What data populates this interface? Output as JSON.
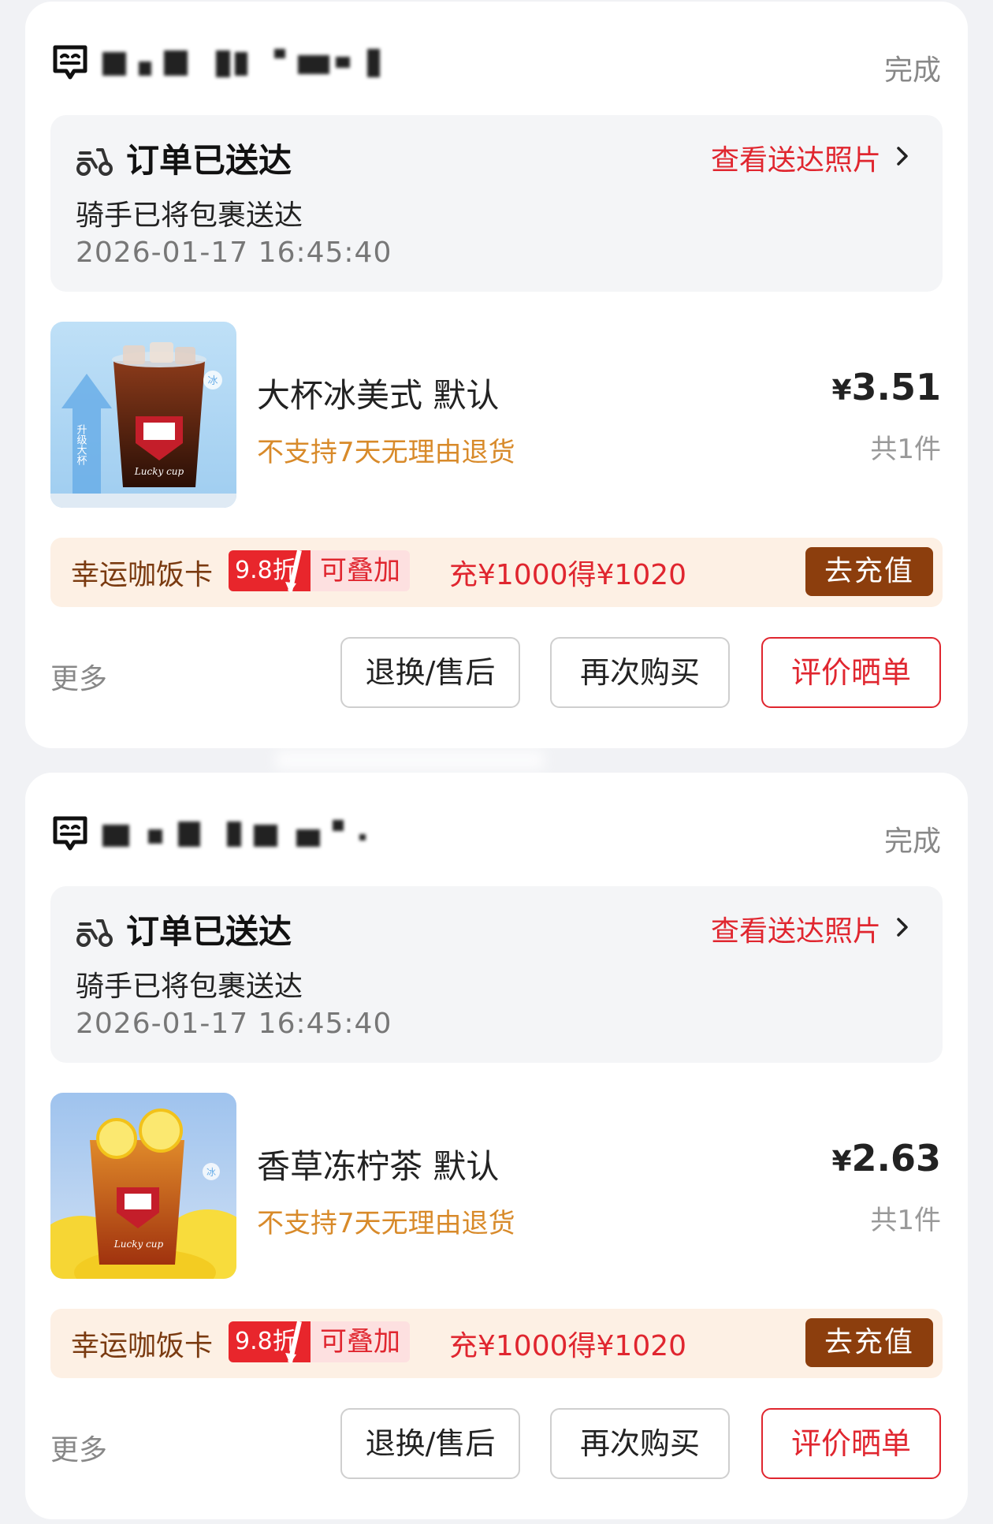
{
  "orders": [
    {
      "status": "完成",
      "delivery": {
        "title": "订单已送达",
        "desc": "骑手已将包裹送达",
        "time": "2026-01-17 16:45:40",
        "photo_link": "查看送达照片"
      },
      "product": {
        "name": "大杯冰美式 默认",
        "note": "不支持7天无理由退货",
        "price_symbol": "¥",
        "price": "3.51",
        "qty": "共1件",
        "image": "iced-americano-cup"
      },
      "promo": {
        "card_name": "幸运咖饭卡",
        "discount": "9.8折",
        "stackable": "可叠加",
        "offer": "充¥1000得¥1020",
        "button": "去充值"
      },
      "actions": {
        "more": "更多",
        "refund": "退换/售后",
        "rebuy": "再次购买",
        "review": "评价晒单"
      }
    },
    {
      "status": "完成",
      "delivery": {
        "title": "订单已送达",
        "desc": "骑手已将包裹送达",
        "time": "2026-01-17 16:45:40",
        "photo_link": "查看送达照片"
      },
      "product": {
        "name": "香草冻柠茶 默认",
        "note": "不支持7天无理由退货",
        "price_symbol": "¥",
        "price": "2.63",
        "qty": "共1件",
        "image": "lemon-tea-cup"
      },
      "promo": {
        "card_name": "幸运咖饭卡",
        "discount": "9.8折",
        "stackable": "可叠加",
        "offer": "充¥1000得¥1020",
        "button": "去充值"
      },
      "actions": {
        "more": "更多",
        "refund": "退换/售后",
        "rebuy": "再次购买",
        "review": "评价晒单"
      }
    }
  ],
  "colors": {
    "accent_red": "#e0262f",
    "brown": "#8c3e0d",
    "orange_note": "#d88a2a"
  }
}
